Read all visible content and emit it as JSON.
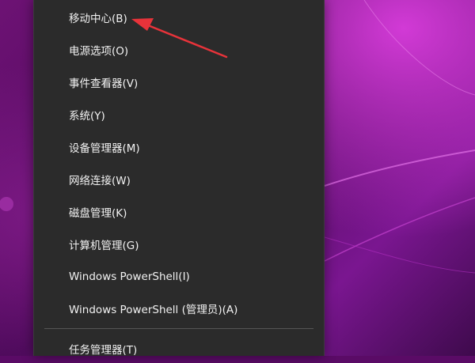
{
  "context_menu": {
    "items": [
      {
        "label": "移动中心(B)"
      },
      {
        "label": "电源选项(O)"
      },
      {
        "label": "事件查看器(V)"
      },
      {
        "label": "系统(Y)"
      },
      {
        "label": "设备管理器(M)"
      },
      {
        "label": "网络连接(W)"
      },
      {
        "label": "磁盘管理(K)"
      },
      {
        "label": "计算机管理(G)"
      },
      {
        "label": "Windows PowerShell(I)"
      },
      {
        "label": "Windows PowerShell (管理员)(A)"
      },
      {
        "label": "任务管理器(T)"
      }
    ]
  },
  "colors": {
    "menu_background": "#2b2b2b",
    "menu_text": "#f2f2f2",
    "annotation_arrow": "#e8333a"
  }
}
